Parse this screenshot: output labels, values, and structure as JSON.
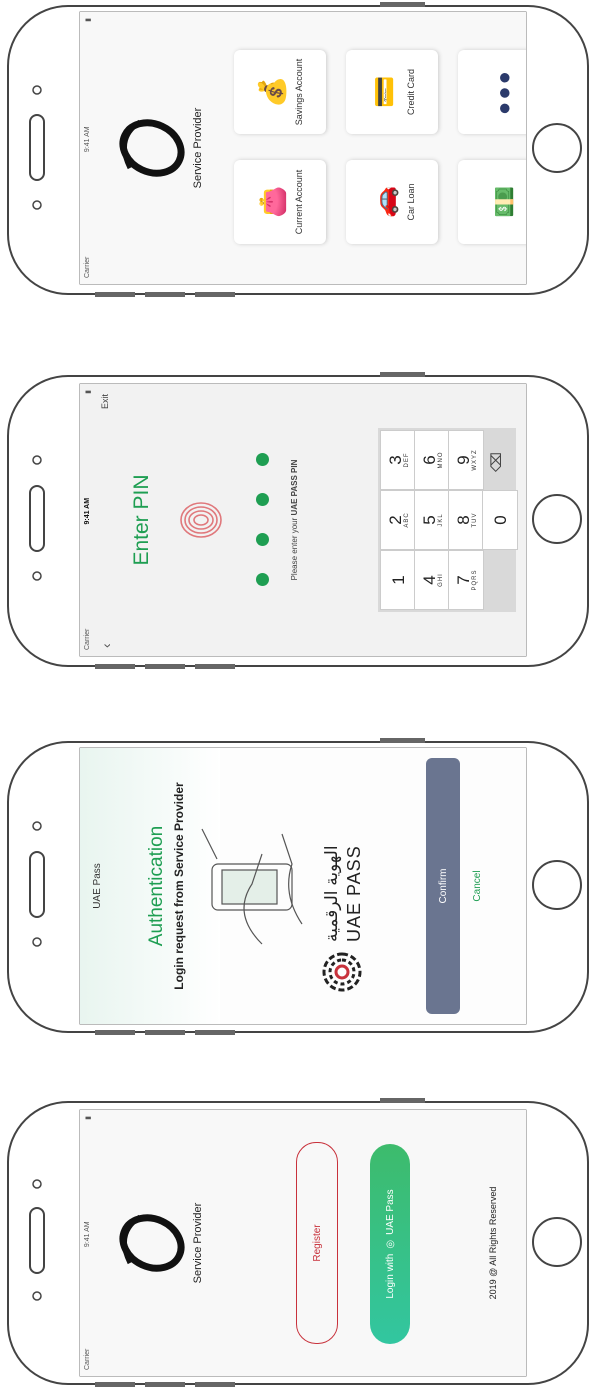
{
  "screen1": {
    "status_carrier": "Carrier",
    "status_time": "9:41 AM",
    "brand": "Service Provider",
    "tiles": [
      {
        "label": "Current Account",
        "icon": "wallet-icon"
      },
      {
        "label": "Savings Account",
        "icon": "money-bag-icon"
      },
      {
        "label": "Car Loan",
        "icon": "car-loan-icon"
      },
      {
        "label": "Credit Card",
        "icon": "credit-card-icon"
      },
      {
        "label": "",
        "icon": "money-hand-icon"
      },
      {
        "label": "",
        "icon": "more-dots-icon"
      }
    ]
  },
  "screen2": {
    "status_carrier": "Carrier",
    "status_time": "9:41 AM",
    "exit": "Exit",
    "title": "Enter PIN",
    "instruction_prefix": "Please enter your ",
    "instruction_bold": "UAE PASS PIN",
    "keys": [
      {
        "num": "1",
        "sub": ""
      },
      {
        "num": "2",
        "sub": "ABC"
      },
      {
        "num": "3",
        "sub": "DEF"
      },
      {
        "num": "4",
        "sub": "GHI"
      },
      {
        "num": "5",
        "sub": "JKL"
      },
      {
        "num": "6",
        "sub": "MNO"
      },
      {
        "num": "7",
        "sub": "PQRS"
      },
      {
        "num": "8",
        "sub": "TUV"
      },
      {
        "num": "9",
        "sub": "WXYZ"
      },
      {
        "num": "",
        "sub": ""
      },
      {
        "num": "0",
        "sub": ""
      },
      {
        "num": "",
        "sub": ""
      }
    ]
  },
  "screen3": {
    "header": "UAE Pass",
    "title": "Authentication",
    "subtitle": "Login request from Service Provider",
    "logo_arabic": "الهوية الرقمية",
    "logo_english": "UAE PASS",
    "confirm": "Confirm",
    "cancel": "Cancel"
  },
  "screen4": {
    "status_carrier": "Carrier",
    "status_time": "9:41 AM",
    "brand": "Service Provider",
    "register": "Register",
    "login_prefix": "Login with",
    "login_suffix": "UAE Pass",
    "footer": "2019 @ All Rights Reserved"
  },
  "colors": {
    "green": "#1e9e52",
    "teal_gradient_start": "#32c6a0",
    "teal_gradient_end": "#3dbb6c",
    "register_red": "#c8323c",
    "confirm_slate": "#6a7590"
  }
}
